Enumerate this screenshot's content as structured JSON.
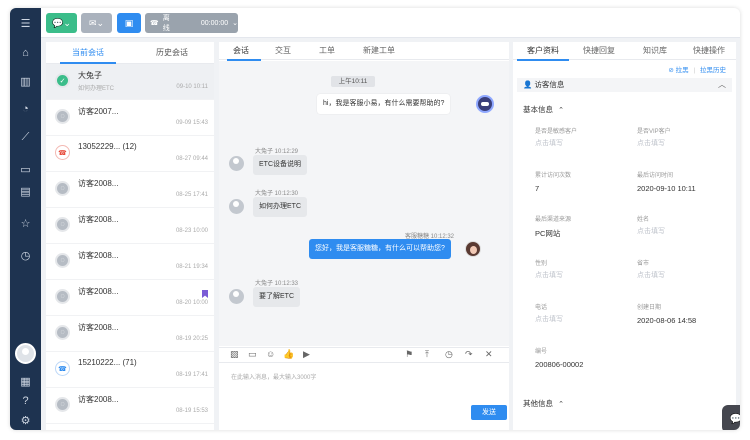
{
  "topbar": {
    "phone_status": "离线",
    "timer": "00:00:00"
  },
  "conv_tabs": [
    "当前会话",
    "历史会话"
  ],
  "conversations": [
    {
      "name": "大兔子",
      "sub": "如何办理ETC",
      "time": "09-10 10:11",
      "icon": "wechat-icon"
    },
    {
      "name": "访客2007...",
      "sub": "",
      "time": "09-09 15:43",
      "icon": "web-visitor-icon"
    },
    {
      "name": "13052229...   (12)",
      "sub": "",
      "time": "08-27 09:44",
      "icon": "missed-call-icon"
    },
    {
      "name": "访客2008...",
      "sub": "",
      "time": "08-25 17:41",
      "icon": "web-visitor-icon"
    },
    {
      "name": "访客2008...",
      "sub": "",
      "time": "08-23 10:00",
      "icon": "web-visitor-icon"
    },
    {
      "name": "访客2008...",
      "sub": "",
      "time": "08-21 19:34",
      "icon": "web-visitor-icon"
    },
    {
      "name": "访客2008...",
      "sub": "",
      "time": "08-20 10:00",
      "icon": "web-visitor-icon"
    },
    {
      "name": "访客2008...",
      "sub": "",
      "time": "08-19 20:25",
      "icon": "web-visitor-icon"
    },
    {
      "name": "15210222...   (71)",
      "sub": "",
      "time": "08-19 17:41",
      "icon": "phone-call-icon"
    },
    {
      "name": "访客2008...",
      "sub": "",
      "time": "08-19 15:53",
      "icon": "web-visitor-icon"
    }
  ],
  "chat_tabs": [
    "会话",
    "交互",
    "工单",
    "新建工单"
  ],
  "chat": {
    "time_chip": "上午10:11",
    "bot_msg": "hi，我是客服小易，有什么需要帮助的?",
    "m1_meta": "大兔子  10:12:29",
    "m1": "ETC设备说明",
    "m2_meta": "大兔子  10:12:30",
    "m2": "如何办理ETC",
    "m3_meta": "客服糖糖  10:12:32",
    "m3": "您好，我是客服糖糖，有什么可以帮助您?",
    "m4_meta": "大兔子  10:12:33",
    "m4": "要了解ETC",
    "input_placeholder": "在此输入消息，最大输入3000字",
    "send": "发送"
  },
  "right_tabs": [
    "客户资料",
    "快捷回复",
    "知识库",
    "快捷操作"
  ],
  "right_links": [
    "⊘ 拉黑",
    "|",
    "拉黑历史"
  ],
  "visitor_section": "访客信息",
  "basic_info": "基本信息",
  "fields": [
    {
      "label": "是否是敏感客户",
      "value": "",
      "placeholder": "点击填写"
    },
    {
      "label": "是否VIP客户",
      "value": "",
      "placeholder": "点击填写"
    },
    {
      "label": "累计访问次数",
      "value": "7",
      "placeholder": ""
    },
    {
      "label": "最后访问时间",
      "value": "2020-09-10 10:11",
      "placeholder": ""
    },
    {
      "label": "最后渠道来源",
      "value": "PC网站",
      "placeholder": ""
    },
    {
      "label": "姓名",
      "value": "",
      "placeholder": "点击填写"
    },
    {
      "label": "性别",
      "value": "",
      "placeholder": "点击填写"
    },
    {
      "label": "省市",
      "value": "",
      "placeholder": "点击填写"
    },
    {
      "label": "电话",
      "value": "",
      "placeholder": "点击填写"
    },
    {
      "label": "创建日期",
      "value": "2020-08-06 14:58",
      "placeholder": ""
    },
    {
      "label": "编号",
      "value": "200806-00002",
      "placeholder": ""
    }
  ],
  "other_info": "其他信息",
  "colors": {
    "nav": "#1e3350",
    "accent": "#2f8cf0",
    "green": "#3bbd8a"
  }
}
